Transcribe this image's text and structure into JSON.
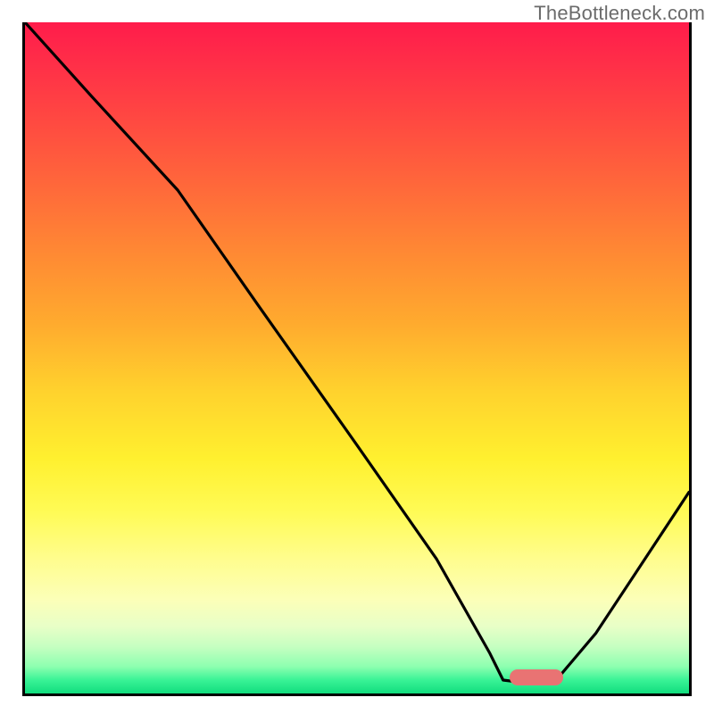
{
  "watermark": "TheBottleneck.com",
  "colors": {
    "frame_border": "#000000",
    "curve_stroke": "#000000",
    "marker_fill": "#e97373",
    "watermark_text": "#6b6b6b",
    "gradient_top": "#ff1c4b",
    "gradient_bottom": "#11dd7e"
  },
  "chart_data": {
    "type": "line",
    "title": "",
    "xlabel": "",
    "ylabel": "",
    "xlim": [
      0,
      100
    ],
    "ylim": [
      0,
      100
    ],
    "grid": false,
    "notes": "No tick labels or axis text are rendered in the image. x and y are expressed as 0–100 fractions of the plot area. y=0 is the bottom (green) and y=100 is the top (red). The curve starts at the top-left, bends near x≈23, descends to a flat minimum around x≈72–80, then rises toward the right edge.",
    "series": [
      {
        "name": "bottleneck-curve",
        "x": [
          0,
          10,
          23,
          35,
          50,
          62,
          70,
          72,
          76,
          80,
          86,
          92,
          100
        ],
        "y": [
          100,
          89,
          75,
          58,
          37,
          20,
          6,
          2,
          1.5,
          2,
          9,
          18,
          30
        ]
      }
    ],
    "marker": {
      "name": "optimal-range",
      "x_start": 73,
      "x_end": 81,
      "y": 2
    }
  }
}
